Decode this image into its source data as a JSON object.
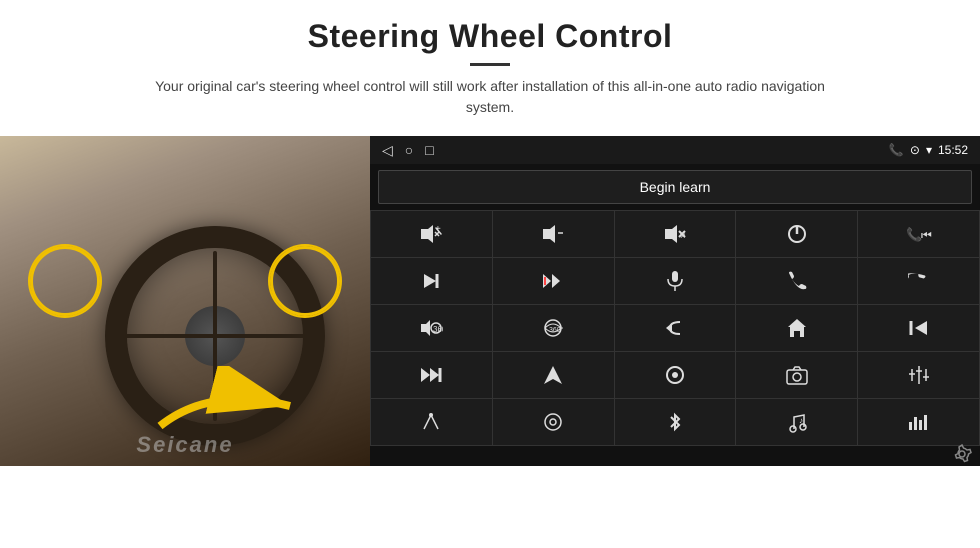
{
  "header": {
    "title": "Steering Wheel Control",
    "subtitle": "Your original car's steering wheel control will still work after installation of this all-in-one auto radio navigation system."
  },
  "android_ui": {
    "status_bar": {
      "nav_back": "◁",
      "nav_home": "○",
      "nav_recents": "□",
      "battery_icon": "▮▮",
      "phone_icon": "📞",
      "location_icon": "⊙",
      "wifi_icon": "▾",
      "time": "15:52"
    },
    "begin_learn_label": "Begin learn",
    "controls": [
      {
        "icon": "🔊+",
        "label": "vol-up"
      },
      {
        "icon": "🔊–",
        "label": "vol-down"
      },
      {
        "icon": "🔇",
        "label": "mute"
      },
      {
        "icon": "⏻",
        "label": "power"
      },
      {
        "icon": "📞⏮",
        "label": "phone-prev"
      },
      {
        "icon": "⏭",
        "label": "next-track"
      },
      {
        "icon": "✂⏭",
        "label": "seek-fwd"
      },
      {
        "icon": "🎤",
        "label": "mic"
      },
      {
        "icon": "📞",
        "label": "call"
      },
      {
        "icon": "↩",
        "label": "hang-up"
      },
      {
        "icon": "📢",
        "label": "speaker"
      },
      {
        "icon": "⊙360",
        "label": "360"
      },
      {
        "icon": "↩",
        "label": "back"
      },
      {
        "icon": "⌂",
        "label": "home"
      },
      {
        "icon": "⏮⏮",
        "label": "prev-track"
      },
      {
        "icon": "⏭⏭",
        "label": "fast-fwd"
      },
      {
        "icon": "▶",
        "label": "nav"
      },
      {
        "icon": "⏺",
        "label": "source"
      },
      {
        "icon": "📷",
        "label": "camera"
      },
      {
        "icon": "⊞",
        "label": "eq"
      },
      {
        "icon": "🎙",
        "label": "voice"
      },
      {
        "icon": "⊙",
        "label": "settings"
      },
      {
        "icon": "✱",
        "label": "bluetooth"
      },
      {
        "icon": "♪",
        "label": "music"
      },
      {
        "icon": "|||",
        "label": "spectrum"
      }
    ],
    "watermark": "Seicane",
    "gear_icon": "⚙"
  }
}
